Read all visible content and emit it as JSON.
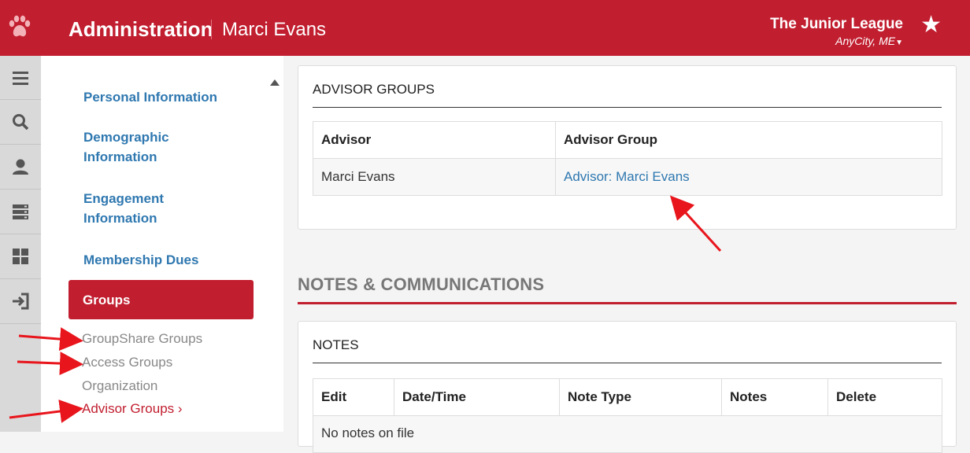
{
  "header": {
    "title": "Administration",
    "user": "Marci Evans",
    "org_name": "The Junior League",
    "org_city": "AnyCity, ME",
    "brand_color": "#c11e2f"
  },
  "icon_bar": [
    "menu-icon",
    "search-icon",
    "person-icon",
    "server-icon",
    "grid-icon",
    "sign-in-icon"
  ],
  "sidebar": {
    "items": [
      {
        "label": "Personal Information"
      },
      {
        "label": "Demographic Information"
      },
      {
        "label": "Engagement Information"
      },
      {
        "label": "Membership Dues"
      }
    ],
    "active": "Groups",
    "subitems": [
      {
        "label": "GroupShare Groups"
      },
      {
        "label": "Access Groups"
      },
      {
        "label": "Organization"
      },
      {
        "label": "Advisor Groups ›"
      }
    ]
  },
  "advisor_groups": {
    "title": "ADVISOR GROUPS",
    "columns": [
      "Advisor",
      "Advisor Group"
    ],
    "rows": [
      {
        "advisor": "Marci Evans",
        "group": "Advisor: Marci Evans"
      }
    ]
  },
  "notes_section": {
    "heading": "NOTES & COMMUNICATIONS",
    "panel_title": "NOTES",
    "columns": [
      "Edit",
      "Date/Time",
      "Note Type",
      "Notes",
      "Delete"
    ],
    "empty_text": "No notes on file"
  }
}
